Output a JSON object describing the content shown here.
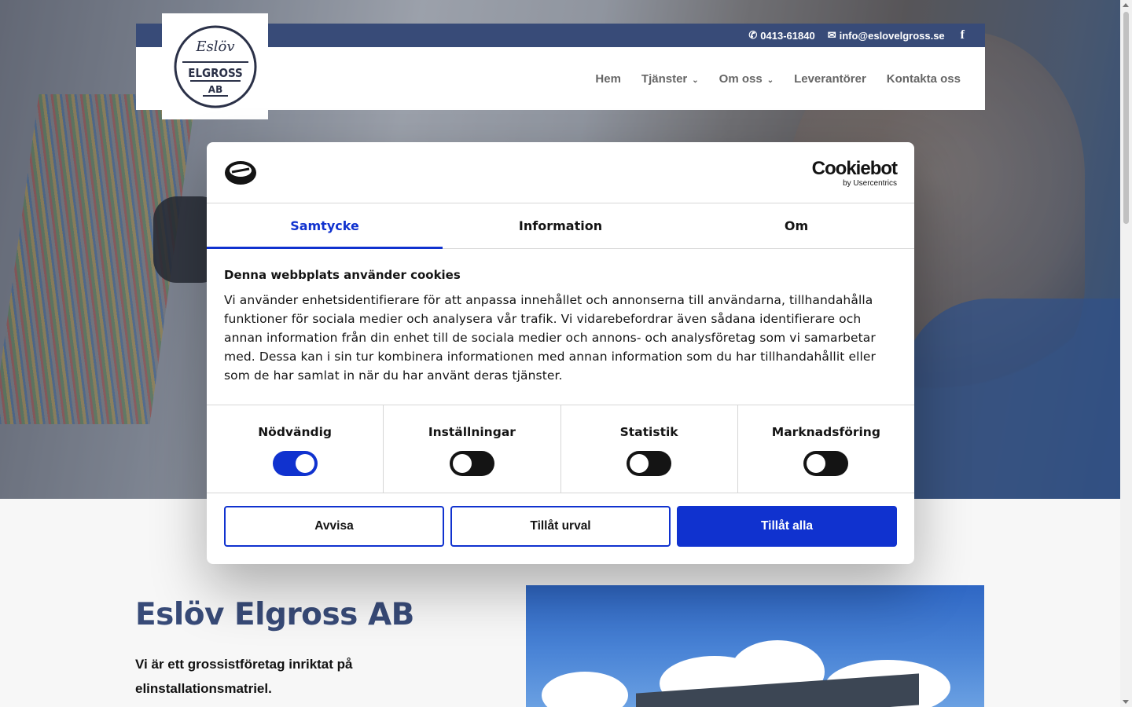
{
  "header": {
    "phone": "0413-61840",
    "email": "info@eslovelgross.se",
    "social_icon": "facebook-icon",
    "logo": {
      "line1": "Eslöv",
      "line2": "ELGROSS",
      "line3": "AB"
    },
    "nav": [
      {
        "label": "Hem",
        "has_dropdown": false
      },
      {
        "label": "Tjänster",
        "has_dropdown": true
      },
      {
        "label": "Om oss",
        "has_dropdown": true
      },
      {
        "label": "Leverantörer",
        "has_dropdown": false
      },
      {
        "label": "Kontakta oss",
        "has_dropdown": false
      }
    ],
    "colors": {
      "brand": "#384b78",
      "nav_text": "#666666"
    }
  },
  "content": {
    "title": "Eslöv Elgross AB",
    "intro": "Vi är ett grossistföretag inriktat på elinstallationsmatriel."
  },
  "cookie_dialog": {
    "brand": {
      "name": "Cookiebot",
      "sub": "by Usercentrics"
    },
    "tabs": [
      {
        "label": "Samtycke",
        "active": true
      },
      {
        "label": "Information",
        "active": false
      },
      {
        "label": "Om",
        "active": false
      }
    ],
    "heading": "Denna webbplats använder cookies",
    "body": "Vi använder enhetsidentifierare för att anpassa innehållet och annonserna till användarna, tillhandahålla funktioner för sociala medier och analysera vår trafik. Vi vidarebefordrar även sådana identifierare och annan information från din enhet till de sociala medier och annons- och analysföretag som vi samarbetar med. Dessa kan i sin tur kombinera informationen med annan information som du har tillhandahållit eller som de har samlat in när du har använt deras tjänster.",
    "toggles": [
      {
        "label": "Nödvändig",
        "on": true
      },
      {
        "label": "Inställningar",
        "on": false
      },
      {
        "label": "Statistik",
        "on": false
      },
      {
        "label": "Marknadsföring",
        "on": false
      }
    ],
    "buttons": {
      "deny": "Avvisa",
      "allow_selection": "Tillåt urval",
      "allow_all": "Tillåt alla"
    },
    "colors": {
      "accent": "#1032cf",
      "text": "#141414"
    }
  }
}
